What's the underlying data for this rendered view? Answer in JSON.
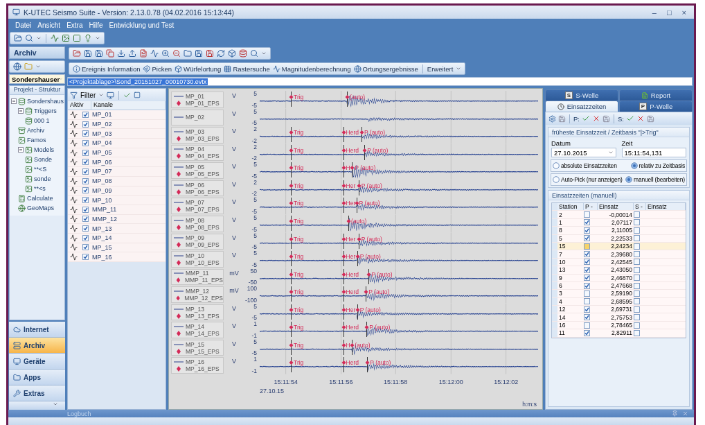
{
  "window": {
    "title": "K-UTEC Seismo Suite - Version: 2.13.0.78 (04.02.2016 15:13:44)",
    "controls": [
      "–",
      "□",
      "×"
    ]
  },
  "menu": [
    "Datei",
    "Ansicht",
    "Extra",
    "Hilfe",
    "Entwicklung und Test"
  ],
  "left_nav": {
    "title": "Archiv",
    "project": "Sondershauser",
    "tree_title": "Projekt - Struktur",
    "tree": [
      {
        "label": "Sondershaus",
        "expanded": true,
        "children": [
          {
            "label": "Triggers",
            "expanded": true,
            "children": [
              {
                "label": "000 1"
              }
            ]
          },
          {
            "label": "Archiv"
          },
          {
            "label": "Famos"
          },
          {
            "label": "Models",
            "expanded": true,
            "children": [
              {
                "label": "Sonde"
              },
              {
                "label": "**<S"
              },
              {
                "label": "sonde"
              },
              {
                "label": "**<s"
              }
            ]
          },
          {
            "label": "Calculate"
          },
          {
            "label": "GeoMaps"
          }
        ]
      }
    ],
    "nav_buttons": [
      {
        "label": "Internet",
        "selected": false
      },
      {
        "label": "Archiv",
        "selected": true
      },
      {
        "label": "Geräte",
        "selected": false
      },
      {
        "label": "Apps",
        "selected": false
      },
      {
        "label": "Extras",
        "selected": false
      }
    ]
  },
  "event_toolbar": {
    "items": [
      "Ereignis Information",
      "Picken",
      "Würfelortung",
      "Rastersuche",
      "Magnitudenberechnung",
      "Ortungsergebnisse"
    ],
    "more": "Erweitert"
  },
  "path": "<Projektablage>\\Sond_20151027_00010730.evtx",
  "channels": {
    "filter": "Filter",
    "columns": [
      "Aktiv",
      "Kanale"
    ],
    "rows": [
      {
        "name": "MP_01",
        "checked": true
      },
      {
        "name": "MP_02",
        "checked": true
      },
      {
        "name": "MP_03",
        "checked": true
      },
      {
        "name": "MP_04",
        "checked": true
      },
      {
        "name": "MP_05",
        "checked": true
      },
      {
        "name": "MP_06",
        "checked": true
      },
      {
        "name": "MP_07",
        "checked": true
      },
      {
        "name": "MP_08",
        "checked": true
      },
      {
        "name": "MP_09",
        "checked": true
      },
      {
        "name": "MP_10",
        "checked": true
      },
      {
        "name": "MMP_11",
        "checked": true
      },
      {
        "name": "MMP_12",
        "checked": true
      },
      {
        "name": "MP_13",
        "checked": true
      },
      {
        "name": "MP_14",
        "checked": true
      },
      {
        "name": "MP_15",
        "checked": true
      },
      {
        "name": "MP_16",
        "checked": true
      }
    ]
  },
  "plot": {
    "rows": [
      {
        "name": "MP_01",
        "eps": "MP_01_EPS",
        "unit": "V",
        "max": "5",
        "min": "-5",
        "markers": [
          {
            "kind": "trig",
            "label": "Trig"
          },
          {
            "kind": "pick",
            "label": "(auto)"
          }
        ]
      },
      {
        "name": "MP_02",
        "unit": "V",
        "max": "5",
        "min": "-5",
        "markers": []
      },
      {
        "name": "MP_03",
        "eps": "MP_03_EPS",
        "unit": "V",
        "max": "2",
        "min": "-2",
        "markers": [
          {
            "kind": "trig",
            "label": "Trig"
          },
          {
            "kind": "herd",
            "label": "Herd"
          },
          {
            "kind": "pick",
            "label": "P (auto)"
          }
        ]
      },
      {
        "name": "MP_04",
        "eps": "MP_04_EPS",
        "unit": "V",
        "max": "2",
        "min": "-2",
        "markers": [
          {
            "kind": "trig",
            "label": "Trig"
          },
          {
            "kind": "herd",
            "label": "Herd"
          },
          {
            "kind": "pick",
            "label": "P (auto)"
          }
        ]
      },
      {
        "name": "MP_05",
        "eps": "MP_05_EPS",
        "unit": "V",
        "max": "5",
        "min": "-5",
        "markers": [
          {
            "kind": "trig",
            "label": "Trig"
          },
          {
            "kind": "herd",
            "label": "H"
          },
          {
            "kind": "pick",
            "label": "P (auto)"
          }
        ]
      },
      {
        "name": "MP_06",
        "eps": "MP_06_EPS",
        "unit": "V",
        "max": "2",
        "min": "-2",
        "markers": [
          {
            "kind": "trig",
            "label": "Trig"
          },
          {
            "kind": "herd",
            "label": "Her"
          },
          {
            "kind": "pick",
            "label": "P (auto)"
          }
        ]
      },
      {
        "name": "MP_07",
        "eps": "MP_07_EPS",
        "unit": "V",
        "max": "5",
        "min": "-5",
        "markers": [
          {
            "kind": "trig",
            "label": "Trig"
          },
          {
            "kind": "herd",
            "label": "Her"
          },
          {
            "kind": "pick",
            "label": "P (auto)"
          }
        ]
      },
      {
        "name": "MP_08",
        "eps": "MP_08_EPS",
        "unit": "V",
        "max": "5",
        "min": "-5",
        "markers": [
          {
            "kind": "trig",
            "label": "Trig"
          },
          {
            "kind": "pick",
            "label": "(auto)"
          }
        ]
      },
      {
        "name": "MP_09",
        "eps": "MP_09_EPS",
        "unit": "V",
        "max": "5",
        "min": "-5",
        "markers": [
          {
            "kind": "trig",
            "label": "Trig"
          },
          {
            "kind": "herd",
            "label": "Her"
          },
          {
            "kind": "pick",
            "label": "P (auto)"
          }
        ]
      },
      {
        "name": "MP_10",
        "eps": "MP_10_EPS",
        "unit": "V",
        "max": "5",
        "min": "-5",
        "markers": [
          {
            "kind": "trig",
            "label": "Trig"
          },
          {
            "kind": "herd",
            "label": "Her"
          },
          {
            "kind": "pick",
            "label": "P (auto)"
          }
        ]
      },
      {
        "name": "MMP_11",
        "eps": "MMP_11_EPS",
        "unit": "mV",
        "max": "50",
        "min": "-50",
        "markers": [
          {
            "kind": "trig",
            "label": "Trig"
          },
          {
            "kind": "herd",
            "label": "Herd"
          },
          {
            "kind": "pick",
            "label": "P (auto)"
          }
        ]
      },
      {
        "name": "MMP_12",
        "eps": "MMP_12_EPS",
        "unit": "mV",
        "max": "100",
        "min": "-100",
        "markers": [
          {
            "kind": "trig",
            "label": "Trig"
          },
          {
            "kind": "herd",
            "label": "Herd"
          },
          {
            "kind": "pick",
            "label": "P (auto)"
          }
        ]
      },
      {
        "name": "MP_13",
        "eps": "MP_13_EPS",
        "unit": "V",
        "max": "5",
        "min": "-5",
        "markers": [
          {
            "kind": "trig",
            "label": "Trig"
          },
          {
            "kind": "herd",
            "label": "Her"
          },
          {
            "kind": "pick",
            "label": "P (auto)"
          }
        ]
      },
      {
        "name": "MP_14",
        "eps": "MP_14_EPS",
        "unit": "V",
        "max": "1",
        "min": "-1",
        "markers": [
          {
            "kind": "trig",
            "label": "Trig"
          },
          {
            "kind": "herd",
            "label": "Herd"
          },
          {
            "kind": "pick",
            "label": "P (auto)"
          }
        ]
      },
      {
        "name": "MP_15",
        "eps": "MP_15_EPS",
        "unit": "V",
        "max": "5",
        "min": "-5",
        "markers": [
          {
            "kind": "trig",
            "label": "Trig"
          },
          {
            "kind": "herd",
            "label": "H"
          },
          {
            "kind": "pick",
            "label": "(auto)"
          }
        ]
      },
      {
        "name": "MP_16",
        "eps": "MP_16_EPS",
        "unit": "V",
        "max": "1",
        "min": "-1",
        "markers": [
          {
            "kind": "trig",
            "label": "Trig"
          },
          {
            "kind": "herd",
            "label": "Herd"
          },
          {
            "kind": "pick",
            "label": "P (auto)"
          }
        ]
      }
    ],
    "xticks": [
      "15:11:54",
      "15:11:56",
      "15:11:58",
      "15:12:00",
      "15:12:02"
    ],
    "date": "27.10.15",
    "time_format": "h:m:s"
  },
  "right_panel": {
    "tab_rows": [
      [
        {
          "label": "S-Welle",
          "badge": "S",
          "selected": false
        },
        {
          "label": "Report",
          "selected": false
        }
      ],
      [
        {
          "label": "Einsatzzeiten",
          "selected": true
        },
        {
          "label": "P-Welle",
          "badge": "P",
          "selected": false
        }
      ]
    ],
    "toolbar": {
      "p_label": "P:",
      "s_label": "S:"
    },
    "basis": {
      "title": "früheste Einsatzzeit / Zeitbasis \"|>Trig\"",
      "date_label": "Datum",
      "date": "27.10.2015",
      "time_label": "Zeit",
      "time": "15:11:54,131",
      "display_mode": [
        {
          "label": "absolute Einsatzzeiten",
          "selected": false
        },
        {
          "label": "relativ zu Zeitbasis",
          "selected": true
        }
      ],
      "pick_mode": [
        {
          "label": "Auto-Pick (nur anzeigen)",
          "selected": false
        },
        {
          "label": "manuell (bearbeiten)",
          "selected": true
        }
      ]
    },
    "table": {
      "title": "Einsatzzeiten (manuell)",
      "columns": [
        "Station",
        "P -",
        "Einsatz",
        "S -",
        "Einsatz"
      ],
      "rows": [
        {
          "station": "2",
          "selected": false,
          "p_checked": false,
          "p_value": "-0,00014",
          "s_checked": false
        },
        {
          "station": "1",
          "selected": false,
          "p_checked": true,
          "p_value": "2,07117",
          "s_checked": false
        },
        {
          "station": "8",
          "selected": false,
          "p_checked": true,
          "p_value": "2,11005",
          "s_checked": false
        },
        {
          "station": "5",
          "selected": false,
          "p_checked": true,
          "p_value": "2,22533",
          "s_checked": false
        },
        {
          "station": "15",
          "selected": true,
          "p_checked": false,
          "p_value": "2,24234",
          "s_checked": false
        },
        {
          "station": "7",
          "selected": false,
          "p_checked": true,
          "p_value": "2,39680",
          "s_checked": false
        },
        {
          "station": "10",
          "selected": false,
          "p_checked": true,
          "p_value": "2,42545",
          "s_checked": false
        },
        {
          "station": "13",
          "selected": false,
          "p_checked": true,
          "p_value": "2,43050",
          "s_checked": false
        },
        {
          "station": "9",
          "selected": false,
          "p_checked": true,
          "p_value": "2,46870",
          "s_checked": false
        },
        {
          "station": "6",
          "selected": false,
          "p_checked": true,
          "p_value": "2,47668",
          "s_checked": false
        },
        {
          "station": "3",
          "selected": false,
          "p_checked": false,
          "p_value": "2,59190",
          "s_checked": false
        },
        {
          "station": "4",
          "selected": false,
          "p_checked": false,
          "p_value": "2,68595",
          "s_checked": false
        },
        {
          "station": "12",
          "selected": false,
          "p_checked": true,
          "p_value": "2,69731",
          "s_checked": false
        },
        {
          "station": "14",
          "selected": false,
          "p_checked": true,
          "p_value": "2,75753",
          "s_checked": false
        },
        {
          "station": "16",
          "selected": false,
          "p_checked": false,
          "p_value": "2,78465",
          "s_checked": false
        },
        {
          "station": "11",
          "selected": false,
          "p_checked": true,
          "p_value": "2,82911",
          "s_checked": false
        }
      ]
    }
  },
  "logbuch": {
    "title": "Logbuch"
  }
}
